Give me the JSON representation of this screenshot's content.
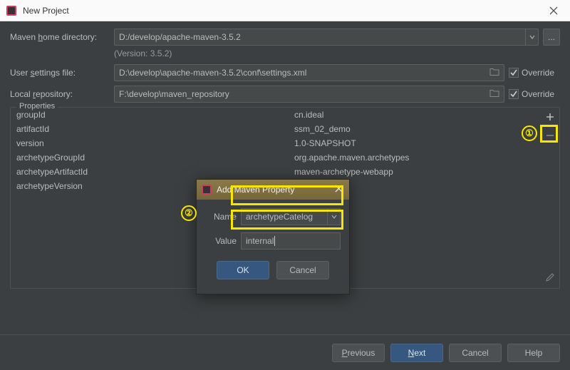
{
  "window": {
    "title": "New Project",
    "version_note": "(Version: 3.5.2)"
  },
  "form": {
    "home_dir_label": "Maven home directory:",
    "home_dir_value": "D:/develop/apache-maven-3.5.2",
    "user_settings_label": "User settings file:",
    "user_settings_value": "D:\\develop\\apache-maven-3.5.2\\conf\\settings.xml",
    "local_repo_label": "Local repository:",
    "local_repo_value": "F:\\develop\\maven_repository",
    "override_label": "Override",
    "dots": "..."
  },
  "properties": {
    "title": "Properties",
    "rows": [
      {
        "k": "groupId",
        "v": "cn.ideal"
      },
      {
        "k": "artifactId",
        "v": "ssm_02_demo"
      },
      {
        "k": "version",
        "v": "1.0-SNAPSHOT"
      },
      {
        "k": "archetypeGroupId",
        "v": "org.apache.maven.archetypes"
      },
      {
        "k": "archetypeArtifactId",
        "v": "maven-archetype-webapp"
      },
      {
        "k": "archetypeVersion",
        "v": ""
      }
    ]
  },
  "modal": {
    "title": "Add Maven Property",
    "name_label": "Name",
    "name_value": "archetypeCatelog",
    "value_label": "Value",
    "value_value": "internal",
    "ok": "OK",
    "cancel": "Cancel"
  },
  "footer": {
    "previous": "Previous",
    "next": "Next",
    "cancel": "Cancel",
    "help": "Help"
  },
  "annotations": {
    "one": "①",
    "two": "②"
  }
}
